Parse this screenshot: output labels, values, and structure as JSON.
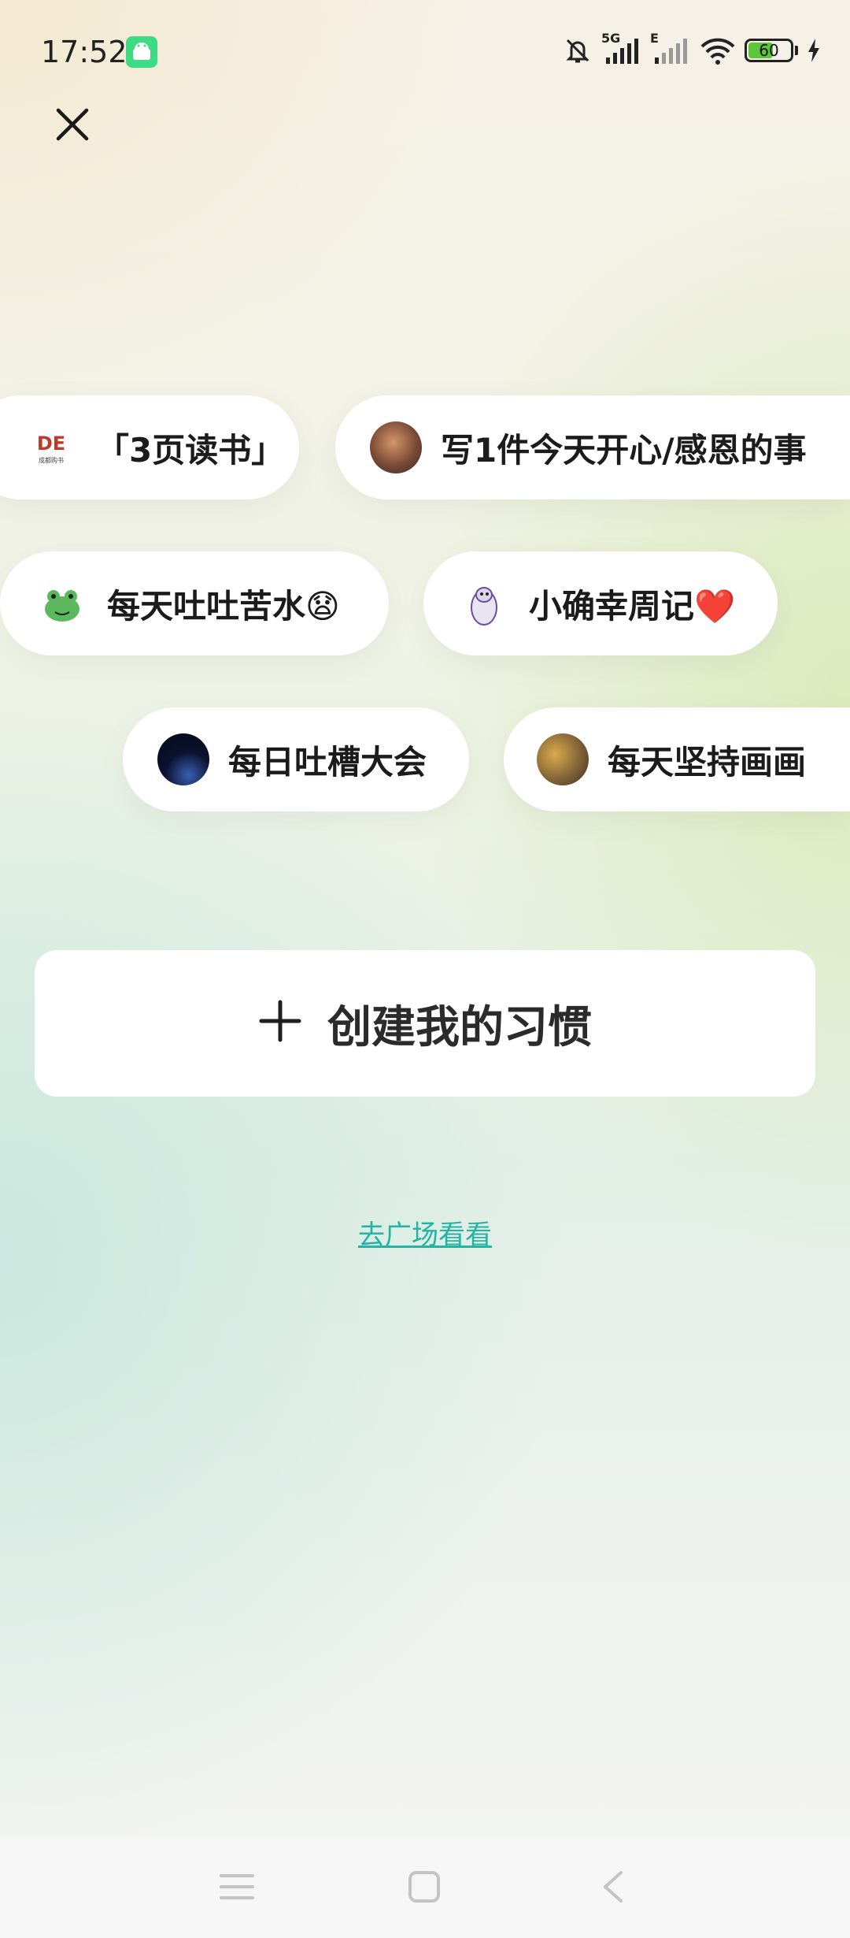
{
  "status_bar": {
    "time": "17:52",
    "network_5g": "5G",
    "network_e": "E",
    "battery_level": "60",
    "battery_percent": 60
  },
  "chips": [
    {
      "label": "「3页读书」",
      "icon": "bookstore-logo"
    },
    {
      "label": "写1件今天开心/感恩的事",
      "icon": "user-avatar"
    },
    {
      "label": "每天吐吐苦水😧",
      "icon": "frog-avatar"
    },
    {
      "label": "小确幸周记❤️",
      "icon": "penguin-avatar"
    },
    {
      "label": "每日吐槽大会",
      "icon": "night-sky-avatar"
    },
    {
      "label": "每天坚持画画",
      "icon": "portrait-avatar"
    }
  ],
  "create": {
    "label": "创建我的习惯"
  },
  "square_link": {
    "label": "去广场看看"
  },
  "colors": {
    "accent": "#25b3a3",
    "battery": "#5cc53a",
    "android": "#3ddc84"
  }
}
